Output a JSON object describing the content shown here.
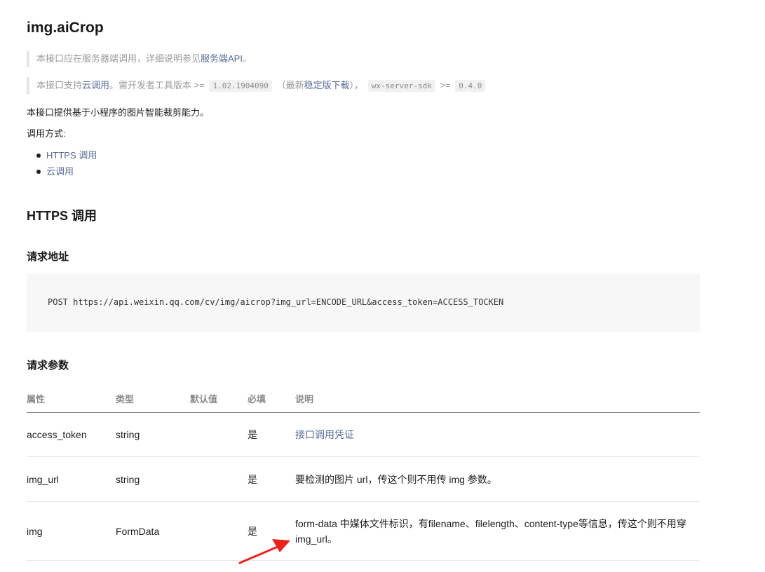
{
  "page": {
    "title": "img.aiCrop",
    "note1": {
      "text": "本接口应在服务器端调用，详细说明参见",
      "link": "服务端API",
      "suffix": "。"
    },
    "note2": {
      "p1": "本接口支持",
      "link1": "云调用",
      "p2": "。需开发者工具版本 >=",
      "code1": "1.02.1904090",
      "p3": "（最新",
      "link2": "稳定版下载",
      "p4": "），",
      "code2": "wx-server-sdk",
      "p5": ">=",
      "code3": "0.4.0"
    },
    "intro": "本接口提供基于小程序的图片智能裁剪能力。",
    "call_methods_label": "调用方式:",
    "call_methods": [
      "HTTPS 调用",
      "云调用"
    ],
    "https_heading": "HTTPS 调用",
    "request_url_heading": "请求地址",
    "request_url": "POST https://api.weixin.qq.com/cv/img/aicrop?img_url=ENCODE_URL&access_token=ACCESS_TOCKEN",
    "request_params_heading": "请求参数"
  },
  "params_table": {
    "headers": [
      "属性",
      "类型",
      "默认值",
      "必填",
      "说明"
    ],
    "rows": [
      {
        "name": "access_token",
        "type": "string",
        "default": "",
        "required": "是",
        "desc": "接口调用凭证",
        "desc_is_link": true
      },
      {
        "name": "img_url",
        "type": "string",
        "default": "",
        "required": "是",
        "desc": "要检测的图片 url，传这个则不用传 img 参数。",
        "desc_is_link": false
      },
      {
        "name": "img",
        "type": "FormData",
        "default": "",
        "required": "是",
        "desc": "form-data 中媒体文件标识，有filename、filelength、content-type等信息，传这个则不用穿 img_url。",
        "desc_is_link": false
      }
    ]
  },
  "colors": {
    "link": "#576b95",
    "annotation_arrow": "#e8231e"
  }
}
